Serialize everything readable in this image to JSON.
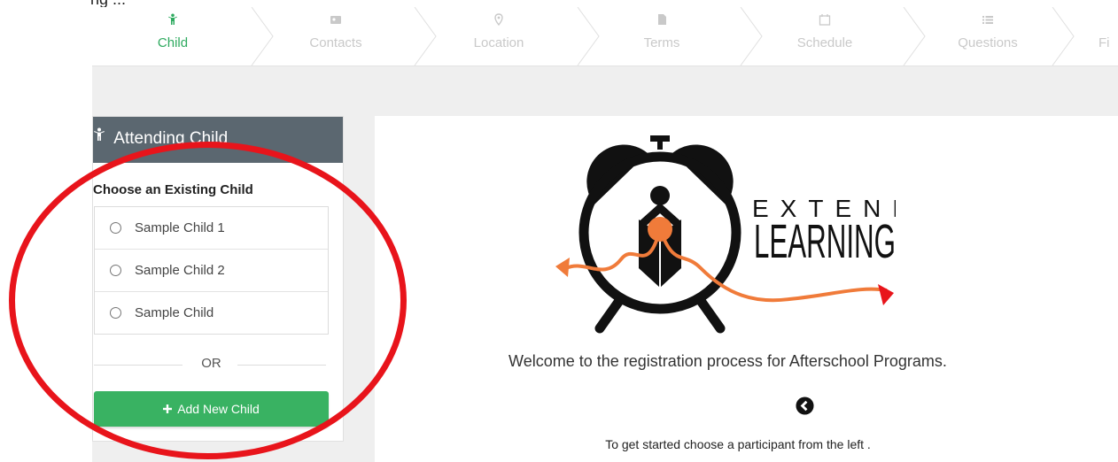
{
  "steps": [
    {
      "label": "Child",
      "icon": "child-icon",
      "active": true
    },
    {
      "label": "Contacts",
      "icon": "contacts-icon",
      "active": false
    },
    {
      "label": "Location",
      "icon": "location-pin-icon",
      "active": false
    },
    {
      "label": "Terms",
      "icon": "document-icon",
      "active": false
    },
    {
      "label": "Schedule",
      "icon": "calendar-icon",
      "active": false
    },
    {
      "label": "Questions",
      "icon": "list-icon",
      "active": false
    },
    {
      "label": "Fi",
      "icon": "finish-icon",
      "active": false
    }
  ],
  "panel": {
    "title": "Attending Child",
    "choose_label": "Choose an Existing Child",
    "children": [
      {
        "name": "Sample Child 1"
      },
      {
        "name": "Sample Child 2"
      },
      {
        "name": "Sample Child"
      }
    ],
    "or_text": "OR",
    "add_label": "Add New Child"
  },
  "main": {
    "logo_word_1": "EXTENDED",
    "logo_word_2": "LEARNING",
    "welcome": "Welcome to the registration process for Afterschool Programs.",
    "started": "To get started choose a participant from the left ."
  },
  "colors": {
    "accent": "#2eaa5f",
    "panel_header": "#5b6770",
    "annotation": "#e8141b",
    "logo_orange": "#f07b3a"
  }
}
